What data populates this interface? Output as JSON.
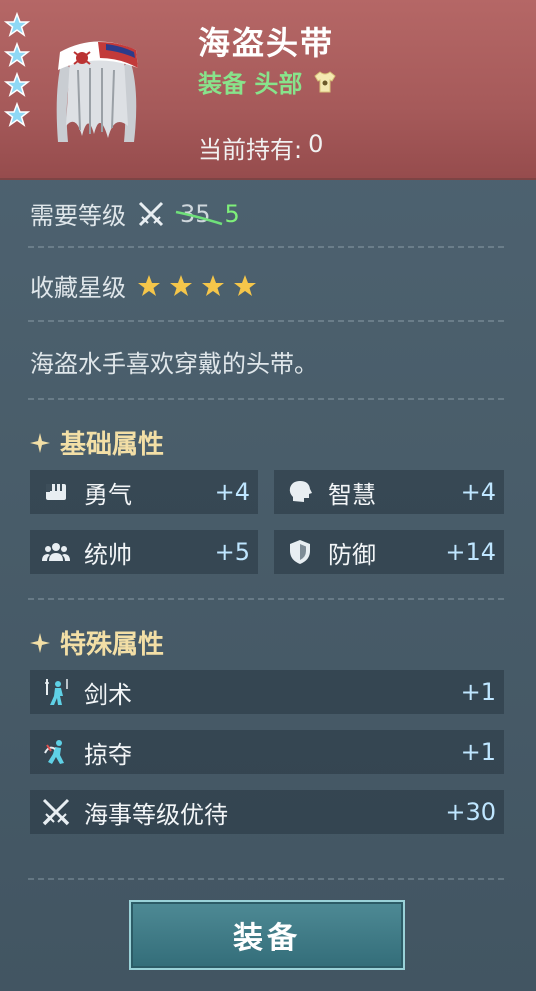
{
  "header": {
    "title": "海盗头带",
    "type_label": "装备 头部",
    "owned_label": "当前持有:",
    "owned_count": "0",
    "badge_stars": 4
  },
  "details": {
    "level_label": "需要等级",
    "level_old": "35",
    "level_new": "5",
    "rarity_label": "收藏星级",
    "rarity_stars": 4,
    "description": "海盗水手喜欢穿戴的头带。"
  },
  "basic_attrs": {
    "title": "基础属性",
    "items": [
      {
        "icon": "fist-icon",
        "label": "勇气",
        "value": "+4"
      },
      {
        "icon": "head-icon",
        "label": "智慧",
        "value": "+4"
      },
      {
        "icon": "group-icon",
        "label": "统帅",
        "value": "+5"
      },
      {
        "icon": "shield-icon",
        "label": "防御",
        "value": "+14"
      }
    ]
  },
  "special_attrs": {
    "title": "特殊属性",
    "items": [
      {
        "icon": "swordsman-icon",
        "label": "剑术",
        "value": "+1"
      },
      {
        "icon": "plunder-icon",
        "label": "掠夺",
        "value": "+1"
      },
      {
        "icon": "crossed-swords-icon",
        "label": "海事等级优待",
        "value": "+30"
      }
    ]
  },
  "actions": {
    "equip_label": "装备"
  },
  "colors": {
    "header_bg": "#a65a5a",
    "panel_bg": "#4a5e6b",
    "level_new": "#7ff07a",
    "type_label": "#88e38b",
    "section_title": "#f3dfa6",
    "attr_value": "#bfe6ff"
  }
}
